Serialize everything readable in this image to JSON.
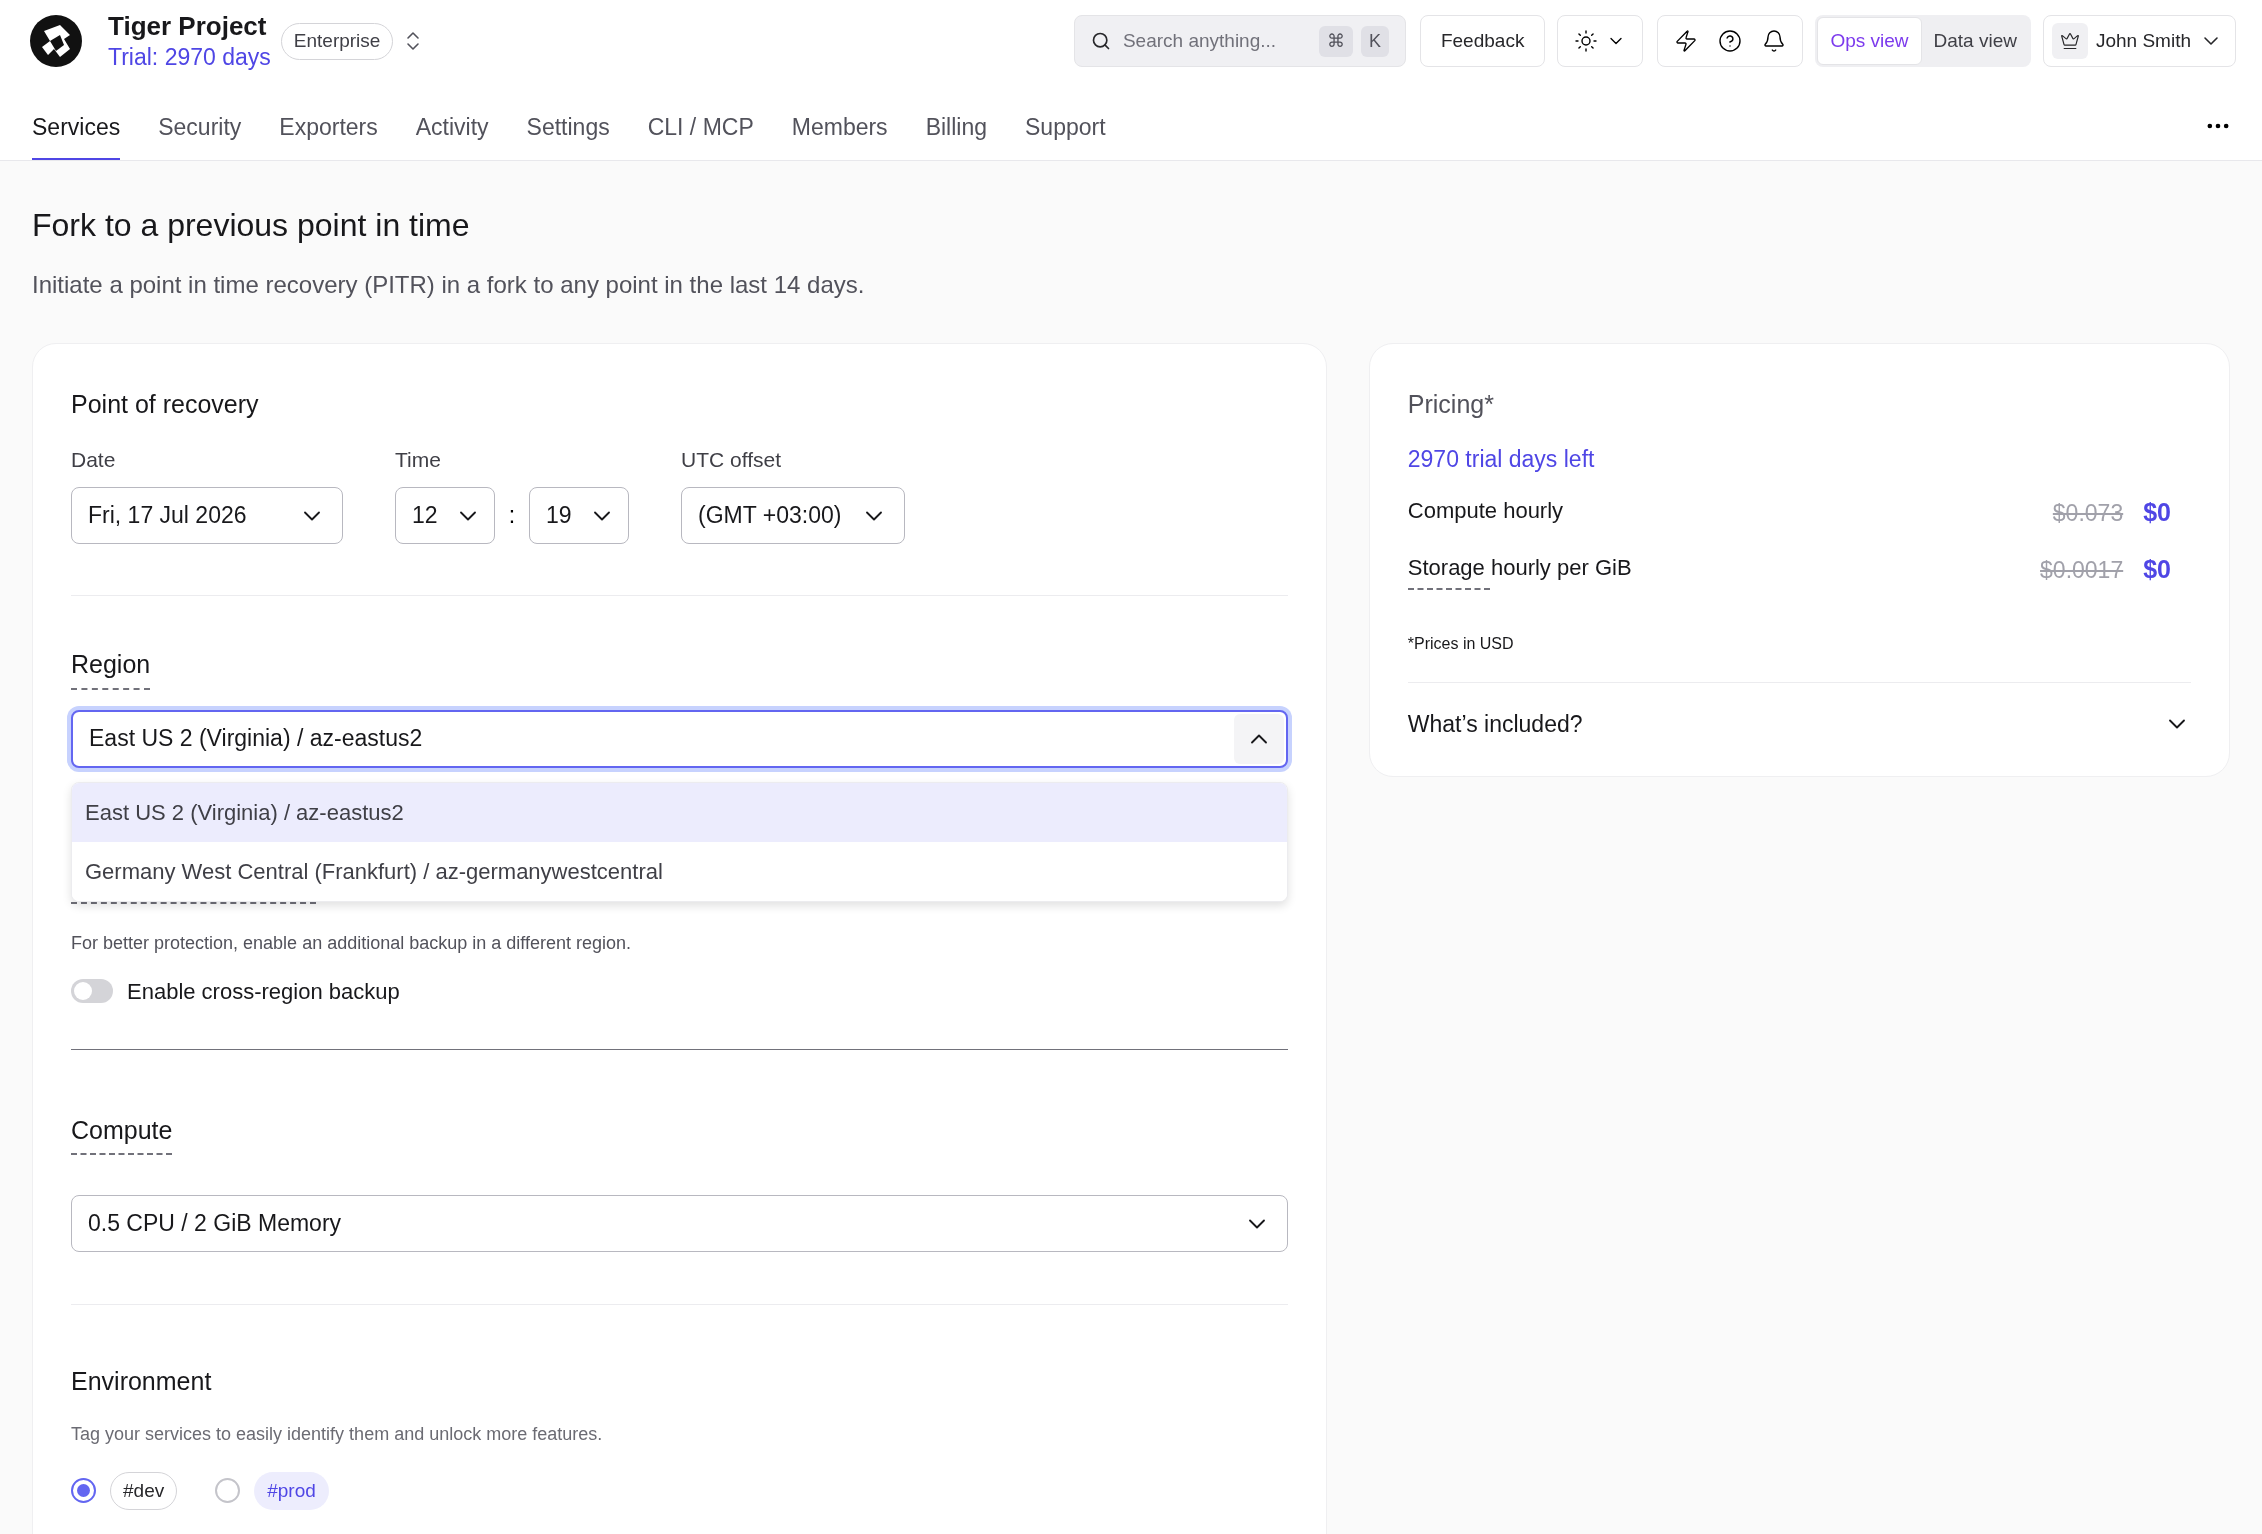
{
  "header": {
    "project": {
      "name": "Tiger Project",
      "trial": "Trial: 2970 days",
      "plan": "Enterprise"
    },
    "search": {
      "placeholder": "Search anything...",
      "keys": [
        "⌘",
        "K"
      ]
    },
    "feedback": "Feedback",
    "views": [
      {
        "label": "Ops view",
        "selected": true
      },
      {
        "label": "Data view",
        "selected": false
      }
    ],
    "user": {
      "name": "John Smith"
    }
  },
  "tabs": [
    {
      "label": "Services",
      "selected": true
    },
    {
      "label": "Security",
      "selected": false
    },
    {
      "label": "Exporters",
      "selected": false
    },
    {
      "label": "Activity",
      "selected": false
    },
    {
      "label": "Settings",
      "selected": false
    },
    {
      "label": "CLI / MCP",
      "selected": false
    },
    {
      "label": "Members",
      "selected": false
    },
    {
      "label": "Billing",
      "selected": false
    },
    {
      "label": "Support",
      "selected": false
    }
  ],
  "page": {
    "title": "Fork to a previous point in time",
    "subtitle": "Initiate a point in time recovery (PITR) in a fork to any point in the last 14 days."
  },
  "recovery": {
    "heading": "Point of recovery",
    "date": {
      "label": "Date",
      "value": "Fri, 17 Jul 2026"
    },
    "time": {
      "label": "Time",
      "hour": "12",
      "separator": ":",
      "minute": "19"
    },
    "utc": {
      "label": "UTC offset",
      "value": "(GMT +03:00)"
    }
  },
  "region": {
    "heading": "Region",
    "hint": true,
    "value": "East US 2 (Virginia) / az-eastus2",
    "expanded": true,
    "options": [
      {
        "label": "East US 2 (Virginia) / az-eastus2",
        "selected": true
      },
      {
        "label": "Germany West Central (Frankfurt) / az-germanywestcentral",
        "selected": false
      }
    ]
  },
  "cross_region": {
    "description": "For better protection, enable an additional backup in a different region.",
    "toggle": {
      "label": "Enable cross-region backup",
      "on": false
    }
  },
  "compute": {
    "heading": "Compute",
    "hint": true,
    "value": "0.5 CPU / 2 GiB Memory"
  },
  "environment": {
    "heading": "Environment",
    "description": "Tag your services to easily identify them and unlock more features.",
    "options": [
      {
        "label": "#dev",
        "selected": true,
        "kind": "outline"
      },
      {
        "label": "#prod",
        "selected": false,
        "kind": "tinted"
      }
    ]
  },
  "pricing": {
    "title": "Pricing*",
    "trial_note": "2970 trial days left",
    "rows": [
      {
        "label": "Compute hourly",
        "hint": false,
        "original": "$0.073",
        "price": "$0"
      },
      {
        "label": "Storage hourly per GiB",
        "hint": true,
        "original": "$0.0017",
        "price": "$0"
      }
    ],
    "footnote": "*Prices in USD",
    "included": {
      "label": "What’s included?",
      "expanded": false
    }
  }
}
